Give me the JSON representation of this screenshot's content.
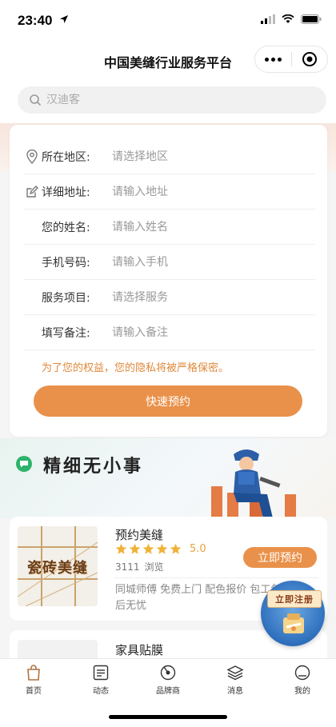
{
  "status_bar": {
    "time": "23:40"
  },
  "nav": {
    "title": "中国美缝行业服务平台"
  },
  "search": {
    "placeholder": "汉迪客"
  },
  "form": {
    "rows": [
      {
        "label": "所在地区:",
        "placeholder": "请选择地区",
        "icon": "location-pin-icon"
      },
      {
        "label": "详细地址:",
        "placeholder": "请输入地址",
        "icon": "edit-icon"
      },
      {
        "label": "您的姓名:",
        "placeholder": "请输入姓名"
      },
      {
        "label": "手机号码:",
        "placeholder": "请输入手机"
      },
      {
        "label": "服务项目:",
        "placeholder": "请选择服务"
      },
      {
        "label": "填写备注:",
        "placeholder": "请输入备注"
      }
    ],
    "privacy_note": "为了您的权益，您的隐私将被严格保密。",
    "submit_label": "快速预约"
  },
  "promo": {
    "title": "精细无小事"
  },
  "listings": [
    {
      "thumb_text": "瓷砖美缝",
      "name": "预约美缝",
      "rating": "5.0",
      "stars": 5,
      "views": "3111",
      "views_label": "浏览",
      "book_label": "立即预约",
      "tags": "同城师傅 免费上门 配色报价 包工包料 售后无忧"
    },
    {
      "name": "家具贴膜"
    }
  ],
  "floating": {
    "register_label": "立即注册"
  },
  "tabs": [
    {
      "label": "首页",
      "icon": "home-bag-icon"
    },
    {
      "label": "动态",
      "icon": "news-icon"
    },
    {
      "label": "品牌商",
      "icon": "brand-icon"
    },
    {
      "label": "消息",
      "icon": "layers-icon"
    },
    {
      "label": "我的",
      "icon": "profile-icon"
    }
  ],
  "colors": {
    "accent": "#e9914a",
    "privacy_text": "#e0893c",
    "star": "#e6a23c",
    "promo_badge": "#2fb36b"
  }
}
